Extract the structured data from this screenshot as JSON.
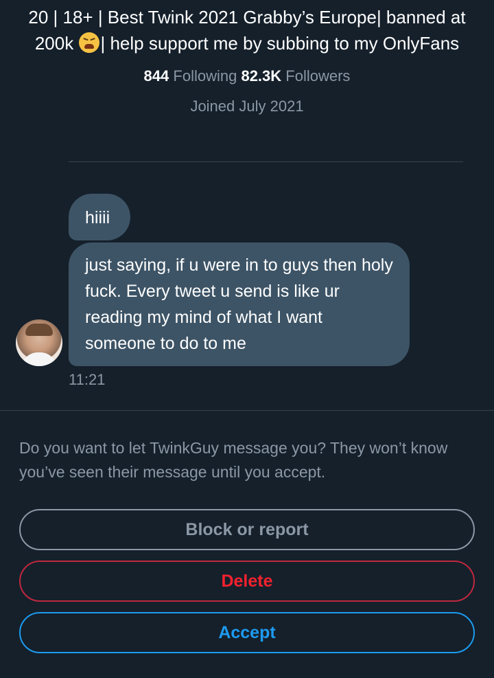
{
  "profile": {
    "bio_part1": "20 | 18+ | Best Twink 2021 Grabby’s Europe| banned at 200k",
    "bio_emoji": "tired-face-emoji",
    "bio_part2": "| help support me by subbing to my OnlyFans",
    "following_count": "844",
    "following_label": "Following",
    "followers_count": "82.3K",
    "followers_label": "Followers",
    "joined": "Joined July 2021"
  },
  "messages": [
    {
      "text": "hiiii"
    },
    {
      "text": "just saying, if u were in to guys then holy fuck. Every tweet u send is like ur reading my mind of what I want someone to do to me"
    }
  ],
  "message_time": "11:21",
  "request": {
    "prompt": "Do you want to let TwinkGuy message you? They won’t know you’ve seen their message until you accept.",
    "block_label": "Block or report",
    "delete_label": "Delete",
    "accept_label": "Accept"
  },
  "colors": {
    "background": "#15202b",
    "bubble": "#3d5466",
    "secondary_text": "#8b98a5",
    "delete": "#f4212e",
    "accept": "#1d9bf0"
  }
}
